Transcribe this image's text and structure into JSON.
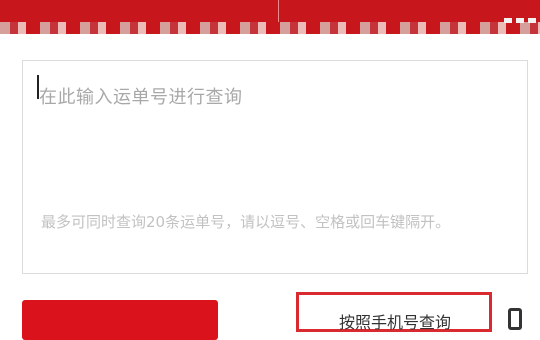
{
  "query": {
    "placeholder": "在此输入运单号进行查询",
    "hint": "最多可同时查询20条运单号，请以逗号、空格或回车键隔开。"
  },
  "actions": {
    "phone_query_label": "按照手机号查询"
  },
  "colors": {
    "brand_red": "#c8161d",
    "button_red": "#d9121b",
    "outline_red": "#d82a2f"
  },
  "icons": [
    "phone-icon"
  ]
}
